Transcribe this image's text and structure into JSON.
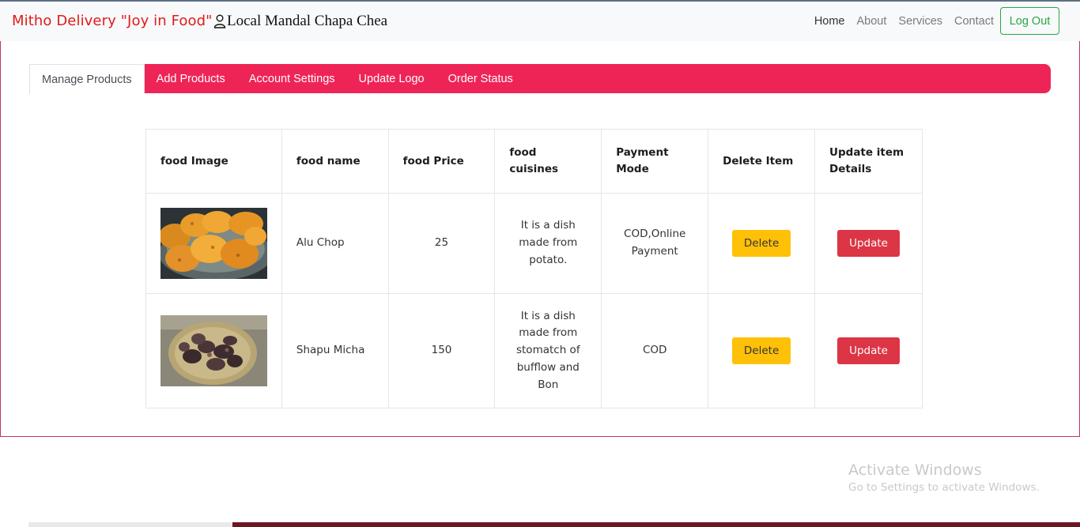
{
  "brand": "Mitho Delivery \"Joy in Food\"",
  "store_name": "Local Mandal Chapa Chea",
  "nav": {
    "home": "Home",
    "about": "About",
    "services": "Services",
    "contact": "Contact",
    "logout": "Log Out"
  },
  "tabs": [
    "Manage Products",
    "Add Products",
    "Account Settings",
    "Update Logo",
    "Order Status"
  ],
  "table": {
    "headers": [
      "food Image",
      "food name",
      "food Price",
      "food cuisines",
      "Payment Mode",
      "Delete Item",
      "Update item Details"
    ],
    "rows": [
      {
        "name": "Alu Chop",
        "price": "25",
        "cuisine": "It is a dish made from potato.",
        "payment": "COD,Online Payment",
        "delete": "Delete",
        "update": "Update"
      },
      {
        "name": "Shapu Micha",
        "price": "150",
        "cuisine": "It is a dish made from stomatch of bufflow and Bon",
        "payment": "COD",
        "delete": "Delete",
        "update": "Update"
      }
    ]
  },
  "watermark": {
    "title": "Activate Windows",
    "subtitle": "Go to Settings to activate Windows."
  },
  "colors": {
    "accent": "#ef2456",
    "brand": "#e01b1b",
    "logout": "#28a745",
    "delete": "#ffc107",
    "update": "#dc3545"
  }
}
